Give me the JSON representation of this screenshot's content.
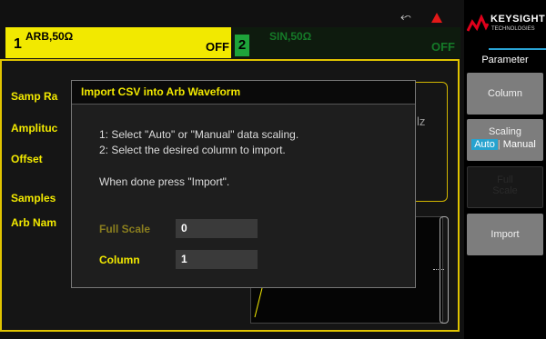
{
  "channel1": {
    "number": "1",
    "info": "ARB,50Ω",
    "state": "OFF"
  },
  "channel2": {
    "number": "2",
    "info": "SIN,50Ω",
    "state": "OFF"
  },
  "status": {
    "usb_icon": "usb-icon",
    "warning_icon": "warning-icon"
  },
  "params": {
    "samp_rate": "Samp Ra",
    "amplitude": "Amplituc",
    "offset": "Offset",
    "samples": "Samples",
    "arb_name": "Arb Nam",
    "unit_fragment": "lz"
  },
  "dialog": {
    "title": "Import CSV into Arb Waveform",
    "line1": "1: Select \"Auto\" or \"Manual\" data scaling.",
    "line2": "2: Select the desired column to import.",
    "line3": "When done press \"Import\".",
    "full_scale_label": "Full Scale",
    "full_scale_value": "0",
    "column_label": "Column",
    "column_value": "1"
  },
  "sidebar": {
    "brand": "KEYSIGHT",
    "brand_sub": "TECHNOLOGIES",
    "title": "Parameter",
    "column_key": "Column",
    "scaling_key": "Scaling",
    "scaling_auto": "Auto",
    "scaling_manual": "Manual",
    "full_scale_line1": "Full",
    "full_scale_line2": "Scale",
    "import_key": "Import"
  },
  "colors": {
    "accent_yellow": "#f2e900",
    "ch2_green": "#1ea33a",
    "toggle_blue": "#27a3cf",
    "brand_red": "#e0001b"
  }
}
